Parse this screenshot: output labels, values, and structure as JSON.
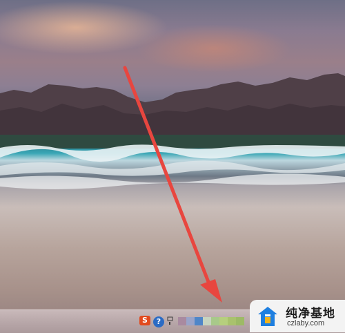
{
  "taskbar": {
    "sogou_icon_text": "S",
    "help_icon_text": "?"
  },
  "watermark": {
    "title": "纯净基地",
    "url": "czlaby.com"
  },
  "colors": {
    "arrow": "#e8463f",
    "badge_bg": "#f3f3f3",
    "logo_blue": "#1e7fe0",
    "logo_yellow": "#f2b21b"
  }
}
